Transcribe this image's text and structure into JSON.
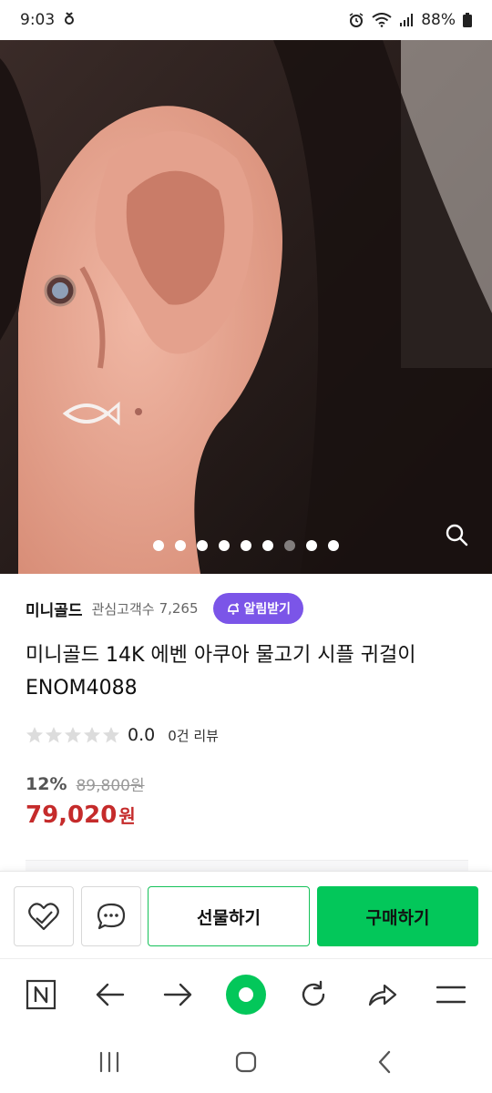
{
  "status": {
    "time": "9:03",
    "battery": "88%"
  },
  "gallery": {
    "total_images": 9,
    "active_index": 6,
    "zoom_icon": "magnifier-icon"
  },
  "store": {
    "name": "미니골드",
    "followers_label": "관심고객수",
    "followers_count": "7,265",
    "alarm_label": "알림받기",
    "alarm_icon": "bell-plus-icon"
  },
  "product": {
    "title": "미니골드 14K 에벤 아쿠아 물고기 시플 귀걸이 ENOM4088",
    "rating": "0.0",
    "review_count": "0건 리뷰",
    "stars_filled": 0,
    "discount": "12%",
    "original_price": "89,800원",
    "sale_price": "79,020",
    "sale_unit": "원"
  },
  "actions": {
    "like_icon": "heart-check-icon",
    "talk_icon": "chat-bubble-icon",
    "gift_label": "선물하기",
    "buy_label": "구매하기"
  },
  "colors": {
    "naver_green": "#03c75a",
    "alarm_purple": "#7B55E8",
    "sale_red": "#c52b2b"
  }
}
